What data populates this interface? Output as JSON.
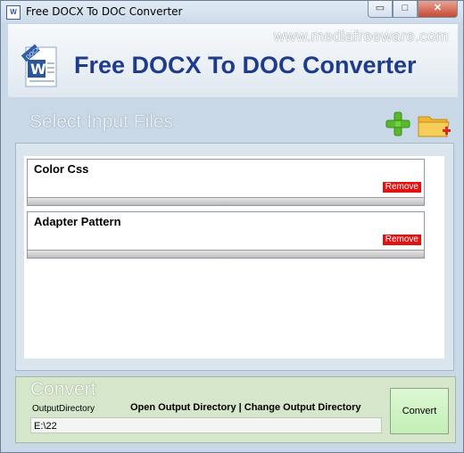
{
  "window": {
    "title": "Free DOCX To DOC Converter",
    "minimize_glyph": "▭",
    "maximize_glyph": "□",
    "close_glyph": "✕"
  },
  "header": {
    "site": "www.mediafreeware.com",
    "app_title": "Free DOCX To DOC Converter",
    "logo_badge": "DOCX",
    "logo_letter": "W"
  },
  "input": {
    "section_label": "Select Input Files",
    "files": [
      {
        "name": "Color Css",
        "remove_label": "Remove"
      },
      {
        "name": "Adapter Pattern",
        "remove_label": "Remove"
      }
    ]
  },
  "convert": {
    "section_label": "Convert",
    "output_label": "OutputDirectory",
    "open_link": "Open Output  Directory",
    "separator": " | ",
    "change_link": "Change Output  Directory",
    "output_value": "E:\\22",
    "button_label": "Convert"
  },
  "colors": {
    "title_blue": "#1f3b8c",
    "remove_red": "#e01212",
    "convert_green": "#c3efb6"
  },
  "icons": [
    "app-icon",
    "word-docx-logo-icon",
    "add-file-icon",
    "add-folder-icon"
  ]
}
